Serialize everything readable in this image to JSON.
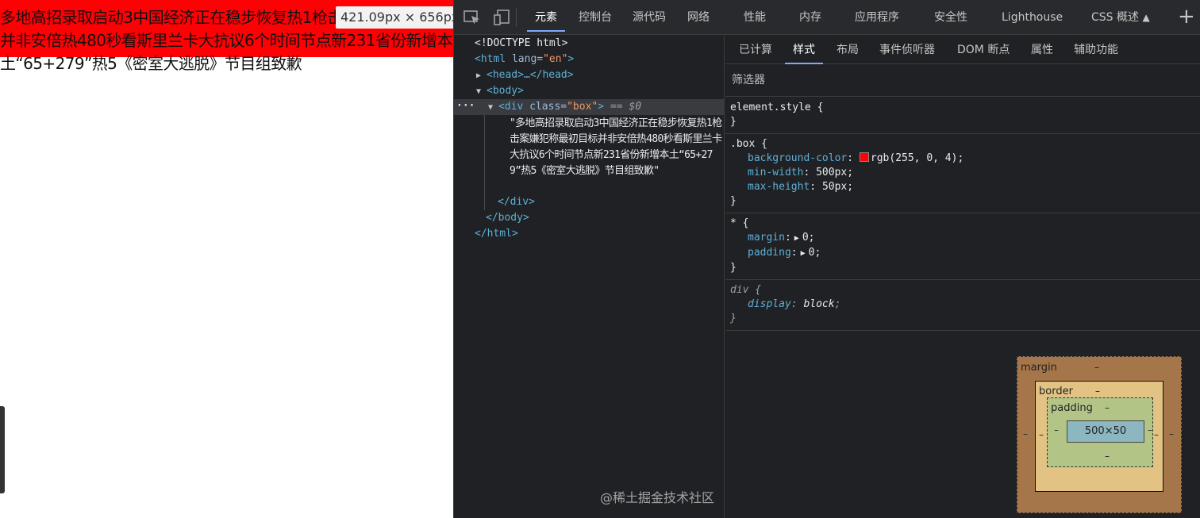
{
  "page": {
    "box_text": "多地高招录取启动3中国经济正在稳步恢复热1枪击案嫌犯称最初目标并非安倍热480秒看斯里兰卡大抗议6个时间节点新231省份新增本土“65+279”热5《密室大逃脱》节目组致歉",
    "size_tooltip": "421.09px × 656px"
  },
  "devtools": {
    "tabs": [
      "元素",
      "控制台",
      "源代码",
      "网络",
      "性能",
      "内存",
      "应用程序",
      "安全性",
      "Lighthouse",
      "CSS 概述"
    ],
    "active_tab": "元素",
    "dom": {
      "doctype": "<!DOCTYPE html>",
      "html_open_tag": "html",
      "html_attr": "lang",
      "html_attr_value": "\"en\"",
      "head": "<head>…</head>",
      "body_open": "<body>",
      "div_tag": "div",
      "div_attr": "class",
      "div_attr_value": "\"box\"",
      "div_eq": "== $0",
      "div_text": "\"多地高招录取启动3中国经济正在稳步恢复热1枪击案嫌犯称最初目标并非安倍热480秒看斯里兰卡大抗议6个时间节点新231省份新增本土“65+279”热5《密室大逃脱》节目组致歉\"",
      "div_close": "</div>",
      "body_close": "</body>",
      "html_close": "</html>",
      "dots": "···"
    },
    "subtabs": [
      "已计算",
      "样式",
      "布局",
      "事件侦听器",
      "DOM 断点",
      "属性",
      "辅助功能"
    ],
    "active_subtab": "样式",
    "filter_placeholder": "筛选器",
    "rules": {
      "element_style": "element.style {",
      "box_selector": ".box {",
      "bg_prop": "background-color",
      "bg_val": "rgb(255, 0, 4)",
      "minw_prop": "min-width",
      "minw_val": "500px",
      "maxh_prop": "max-height",
      "maxh_val": "50px",
      "star_selector": "* {",
      "margin_prop": "margin",
      "margin_val": "0",
      "padding_prop": "padding",
      "padding_val": "0",
      "div_selector": "div {",
      "display_prop": "display",
      "display_val": "block",
      "close": "}"
    },
    "box_model": {
      "margin_label": "margin",
      "border_label": "border",
      "padding_label": "padding",
      "content": "500×50",
      "dash": "–"
    }
  },
  "watermark": "@稀土掘金技术社区",
  "colors": {
    "red_box": "#ff0004",
    "devtools_bg": "#202124"
  }
}
